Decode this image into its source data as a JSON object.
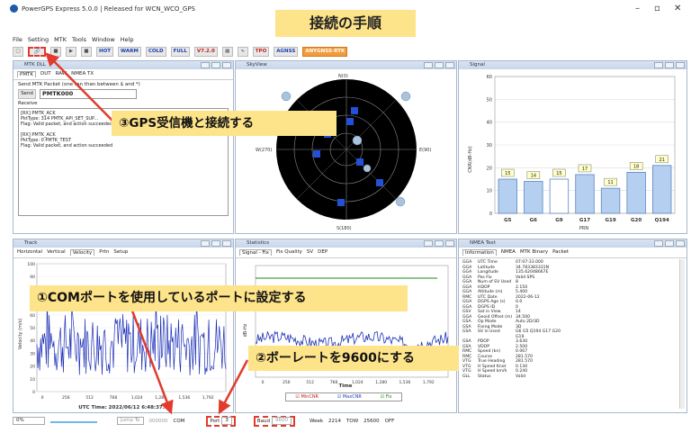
{
  "app": {
    "title": "PowerGPS Express 5.0.0 | Released for WCN_WCO_GPS",
    "heading": "接続の手順",
    "window_controls": [
      "–",
      "▫",
      "✕"
    ]
  },
  "menu": [
    "File",
    "Setting",
    "MTK",
    "Tools",
    "Window",
    "Help"
  ],
  "toolbar": {
    "buttons": [
      "HOT",
      "WARM",
      "COLD",
      "FULL",
      "V7.2.0",
      "TPO",
      "AGNSS"
    ],
    "accent_button": "ANYGNSS-RTK"
  },
  "panels": {
    "mtk": {
      "title": "MTK DLL",
      "tabs": [
        "PMTK",
        "DUT",
        "RAW",
        "NMEA TX"
      ],
      "send_label": "Send MTK Packet (one ran than between $ and *)",
      "send_button": "Send",
      "command": "PMTK000",
      "receive_label": "Receive",
      "log": [
        "[RX] PMTK_ACK",
        "PktType: 314 PMTK_API_SET_SUP...",
        "Flag: Valid packet, and action succeeded",
        "",
        "[RX] PMTK_ACK",
        "PktType: 0 PMTK_TEST",
        "Flag: Valid packet, and action succeeded"
      ]
    },
    "skyview": {
      "title": "SkyView",
      "labels": {
        "north": "N(0)",
        "south": "S(180)",
        "west": "W(270)",
        "east": "E(90)"
      }
    },
    "signal": {
      "title": "Signal",
      "ylabel": "CNR(dB-Hz)",
      "xlabel": "PRN"
    },
    "track": {
      "title": "Track",
      "tabs": [
        "Horizontal",
        "Vertical",
        "Velocity",
        "Prtn",
        "Setup"
      ],
      "ylabel": "Velocity (m/s)",
      "xlabel": "UTC Time: 2022/06/12 6:48:37.0",
      "xticks": [
        "0",
        "256",
        "512",
        "768",
        "1,024",
        "1,280",
        "1,536",
        "1,792"
      ],
      "yticks": [
        "100",
        "90",
        "80",
        "70",
        "60",
        "50",
        "40",
        "30",
        "20",
        "10",
        "0"
      ]
    },
    "statistics": {
      "title": "Statistics",
      "tabs": [
        "Signal - Fix",
        "Fix Quality",
        "SV",
        "DEP"
      ],
      "ylabel": "dB-Hz",
      "xlabel": "Time",
      "level_label": "3D",
      "xticks": [
        "0",
        "256",
        "512",
        "768",
        "1,024",
        "1,280",
        "1,536",
        "1,792"
      ],
      "legend": [
        "MinCNR",
        "MaxCNR",
        "Fix"
      ]
    },
    "nmea": {
      "title": "NMEA Text",
      "tabs": [
        "Information",
        "NMEA",
        "MTK Binary",
        "Packet"
      ],
      "rows": [
        [
          "GGA",
          "UTC Time",
          "07:07:33.000"
        ],
        [
          "GGA",
          "Latitude",
          "34.783383331N"
        ],
        [
          "GGA",
          "Longitude",
          "135.62048667E"
        ],
        [
          "GGA",
          "Pos Fix",
          "Valid SPS"
        ],
        [
          "GGA",
          "Num of SV Used",
          "8"
        ],
        [
          "GGA",
          "HDOP",
          "2.150"
        ],
        [
          "GGA",
          "Altitude (m)",
          "5.400"
        ],
        [
          "RMC",
          "UTC Date",
          "2022-06-12"
        ],
        [
          "GGA",
          "DGPS Age (s)",
          "0.0"
        ],
        [
          "GGA",
          "DGPS ID",
          "0"
        ],
        [
          "GSV",
          "Sat in View",
          "14"
        ],
        [
          "GGA",
          "Geoid Offset (m)",
          "34.500"
        ],
        [
          "GSA",
          "Op Mode",
          "Auto 2D/3D"
        ],
        [
          "GSA",
          "Fixing Mode",
          "3D"
        ],
        [
          "GSA",
          "SV in Used",
          "G6 G5 Q194 G17 G20 G19"
        ],
        [
          "GSA",
          "PDOP",
          "3.630"
        ],
        [
          "GSA",
          "VDOP",
          "2.500"
        ],
        [
          "RMC",
          "Speed (kn)",
          "0.067"
        ],
        [
          "RMC",
          "Course",
          "281.570"
        ],
        [
          "VTG",
          "True Heading",
          "281.570"
        ],
        [
          "VTG",
          "H Speed Knot",
          "0.130"
        ],
        [
          "VTG",
          "H Speed km/h",
          "0.240"
        ],
        [
          "GLL",
          "Status",
          "Valid"
        ]
      ]
    }
  },
  "callouts": {
    "step1": "①COMポートを使用しているポートに設定する",
    "step2": "②ボーレートを9600にする",
    "step3": "③GPS受信機と接続する"
  },
  "statusbar": {
    "progress": "0%",
    "jump_label": "Jump To",
    "jump_value": "000000",
    "com_label": "COM",
    "port_label": "Port",
    "port_value": "3",
    "baud_label": "Baud",
    "baud_value": "9600",
    "week_label": "Week",
    "week_value": "2214",
    "tow_label": "TOW",
    "tow_value": "25600",
    "fix_label": "OFF"
  },
  "chart_data": [
    {
      "type": "bar",
      "categories": [
        "G5",
        "G6",
        "G9",
        "G17",
        "G19",
        "G20",
        "Q194"
      ],
      "values": [
        15,
        14,
        15,
        17,
        11,
        18,
        21
      ],
      "xlabel": "PRN",
      "ylabel": "CNR(dB-Hz)",
      "ylim": [
        0,
        60
      ],
      "yticks": [
        0,
        10,
        20,
        30,
        40,
        50,
        60
      ]
    }
  ],
  "colors": {
    "callout_bg": "#fde38a",
    "dashed_outline": "#e23b2e",
    "arrow": "#e23b2e",
    "bar_fill": "#b4cff0",
    "bar_outline": "#5b86c0"
  }
}
